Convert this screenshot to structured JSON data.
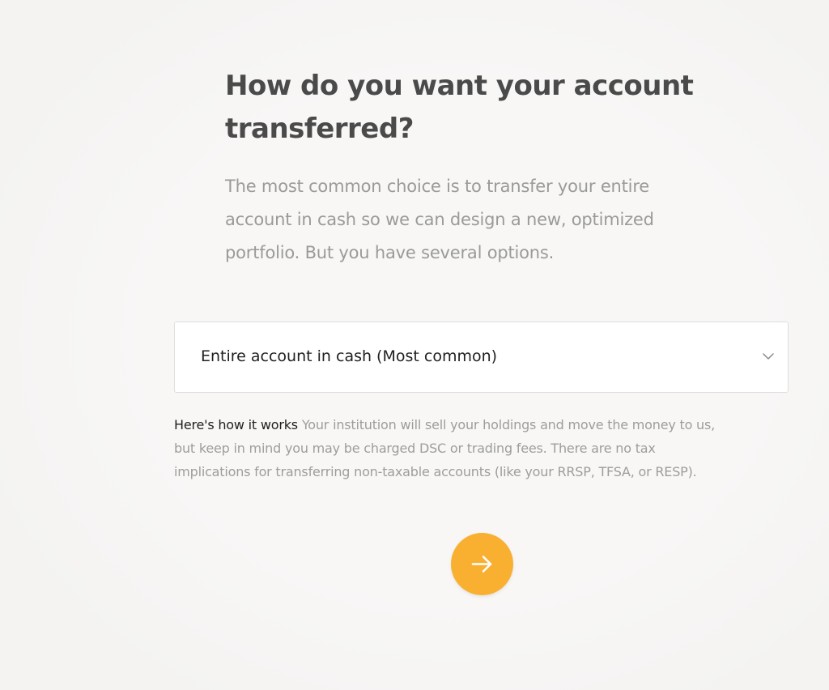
{
  "header": {
    "title_line1": "How do you want your account",
    "title_line2": "transferred?"
  },
  "intro": {
    "line1": "The most common choice is to transfer your entire",
    "line2": "account in cash so we can design a new, optimized",
    "line3": "portfolio. But you have several options."
  },
  "transfer_select": {
    "selected_value": "Entire account in cash (Most common)",
    "icon": "chevron-down-icon"
  },
  "help": {
    "lead": "Here's how it works",
    "text_line1": "Your institution will sell your holdings and move the money to us,",
    "text_line2": "but keep in mind you may be charged DSC or trading fees. There are no tax",
    "text_line3": "implications for transferring non-taxable accounts (like your RRSP, TFSA, or RESP)."
  },
  "next_button": {
    "icon": "arrow-right-icon",
    "color": "#f9b031"
  },
  "colors": {
    "background": "#f9f8f7",
    "title": "#4a4a4a",
    "muted_text": "#9a9a9a",
    "accent": "#f9b031"
  }
}
